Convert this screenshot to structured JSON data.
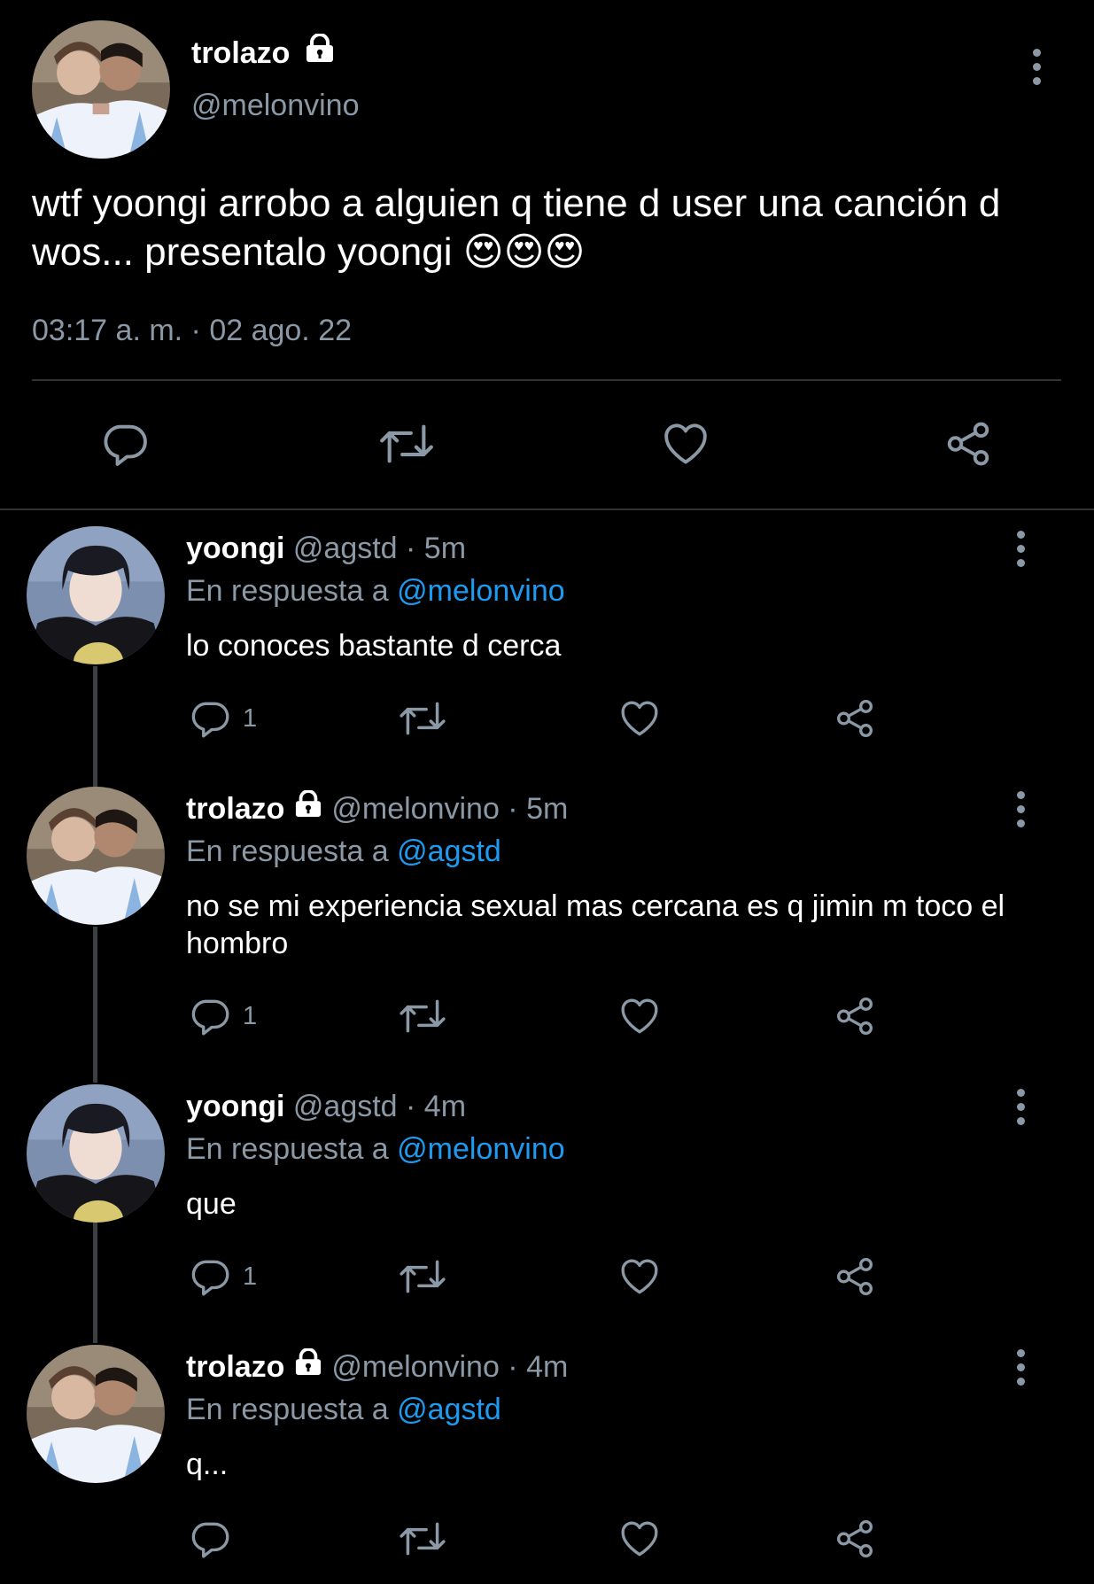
{
  "main_tweet": {
    "display_name": "trolazo",
    "handle": "@melonvino",
    "text": "wtf yoongi arrobo a alguien q tiene d user una canción d wos... presentalo yoongi 😍😍😍",
    "timestamp": "03:17 a. m. · 02 ago. 22"
  },
  "replies": [
    {
      "display_name": "yoongi",
      "locked": false,
      "handle_time": "@agstd · 5m",
      "reply_prefix": "En respuesta a",
      "reply_to": "@melonvino",
      "text": "lo conoces bastante d cerca",
      "reply_count": "1"
    },
    {
      "display_name": "trolazo",
      "locked": true,
      "handle_time": "@melonvino · 5m",
      "reply_prefix": "En respuesta a",
      "reply_to": "@agstd",
      "text": "no se mi experiencia sexual mas cercana es q jimin m toco el hombro",
      "reply_count": "1"
    },
    {
      "display_name": "yoongi",
      "locked": false,
      "handle_time": "@agstd · 4m",
      "reply_prefix": "En respuesta a",
      "reply_to": "@melonvino",
      "text": "que",
      "reply_count": "1"
    },
    {
      "display_name": "trolazo",
      "locked": true,
      "handle_time": "@melonvino · 4m",
      "reply_prefix": "En respuesta a",
      "reply_to": "@agstd",
      "text": "q...",
      "reply_count": ""
    }
  ],
  "icons": [
    "lock-icon",
    "more-icon",
    "reply-icon",
    "retweet-icon",
    "like-icon",
    "share-icon"
  ],
  "colors": {
    "background": "#000000",
    "text": "#e7e9ea",
    "muted": "#8b98a5",
    "link": "#1d9bf0",
    "divider": "#2f3336"
  }
}
